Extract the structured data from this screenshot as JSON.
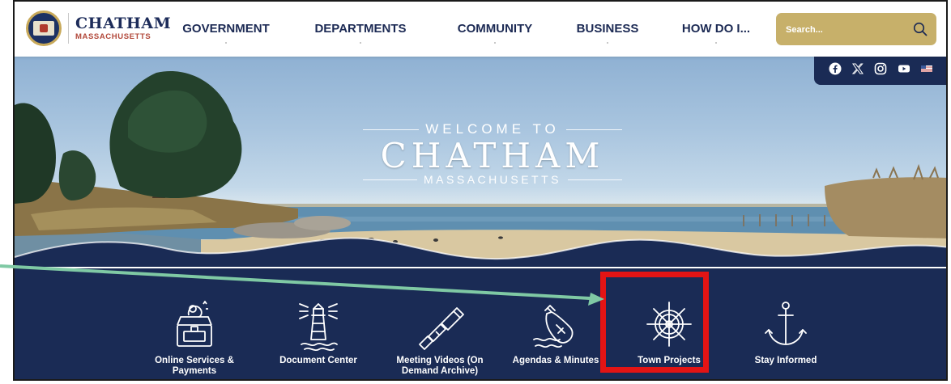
{
  "site": {
    "logo_title": "CHATHAM",
    "logo_subtitle": "MASSACHUSETTS"
  },
  "nav": {
    "items": [
      {
        "label": "GOVERNMENT"
      },
      {
        "label": "DEPARTMENTS"
      },
      {
        "label": "COMMUNITY"
      },
      {
        "label": "BUSINESS"
      },
      {
        "label": "HOW DO I..."
      }
    ]
  },
  "search": {
    "placeholder": "Search...",
    "icon": "search-icon"
  },
  "social": {
    "icons": [
      "facebook-icon",
      "x-icon",
      "instagram-icon",
      "youtube-icon",
      "flag-icon"
    ]
  },
  "hero": {
    "line1": "WELCOME TO",
    "line2": "CHATHAM",
    "line3": "MASSACHUSETTS"
  },
  "quick_links": [
    {
      "label": "Online Services & Payments",
      "icon": "treasure-chest-icon"
    },
    {
      "label": "Document Center",
      "icon": "lighthouse-icon"
    },
    {
      "label": "Meeting Videos (On Demand Archive)",
      "icon": "spyglass-icon"
    },
    {
      "label": "Agendas & Minutes",
      "icon": "message-in-bottle-icon"
    },
    {
      "label": "Town Projects",
      "icon": "ship-wheel-icon"
    },
    {
      "label": "Stay Informed",
      "icon": "anchor-icon"
    }
  ],
  "colors": {
    "navy": "#1a2b55",
    "gold": "#c7b06a",
    "highlight_red": "#e31414",
    "arrow_green": "#7fc9a4"
  }
}
